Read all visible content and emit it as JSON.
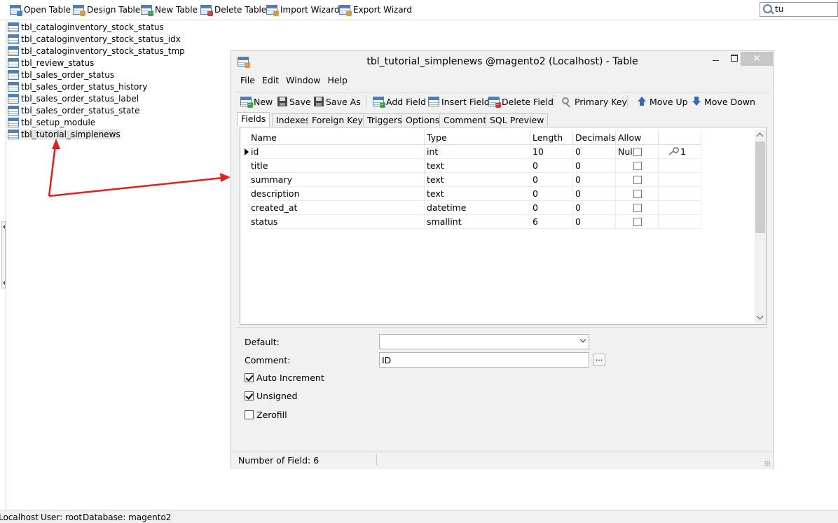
{
  "toolbar": {
    "open_table": "Open Table",
    "design_table": "Design Table",
    "new_table": "New Table",
    "delete_table": "Delete Table",
    "import_wizard": "Import Wizard",
    "export_wizard": "Export Wizard"
  },
  "search": {
    "value": "tu"
  },
  "tree": {
    "items": [
      "tbl_cataloginventory_stock_status",
      "tbl_cataloginventory_stock_status_idx",
      "tbl_cataloginventory_stock_status_tmp",
      "tbl_review_status",
      "tbl_sales_order_status",
      "tbl_sales_order_status_history",
      "tbl_sales_order_status_label",
      "tbl_sales_order_status_state",
      "tbl_setup_module",
      "tbl_tutorial_simplenews"
    ],
    "selected_index": 9
  },
  "window": {
    "title": "tbl_tutorial_simplenews @magento2 (Localhost) - Table",
    "close_glyph": "✕"
  },
  "menu": {
    "file": "File",
    "edit": "Edit",
    "window": "Window",
    "help": "Help"
  },
  "design_toolbar": {
    "new": "New",
    "save": "Save",
    "save_as": "Save As",
    "add_field": "Add Field",
    "insert_field": "Insert Field",
    "delete_field": "Delete Field",
    "primary_key": "Primary Key",
    "move_up": "Move Up",
    "move_down": "Move Down"
  },
  "tabs": [
    "Fields",
    "Indexes",
    "Foreign Keys",
    "Triggers",
    "Options",
    "Comment",
    "SQL Preview"
  ],
  "active_tab": "Fields",
  "grid": {
    "headers": {
      "name": "Name",
      "type": "Type",
      "length": "Length",
      "decimals": "Decimals",
      "allow_null": "Allow Null"
    },
    "rows": [
      {
        "name": "id",
        "type": "int",
        "length": "10",
        "decimals": "0",
        "allow_null": false,
        "key": "1"
      },
      {
        "name": "title",
        "type": "text",
        "length": "0",
        "decimals": "0",
        "allow_null": false,
        "key": ""
      },
      {
        "name": "summary",
        "type": "text",
        "length": "0",
        "decimals": "0",
        "allow_null": false,
        "key": ""
      },
      {
        "name": "description",
        "type": "text",
        "length": "0",
        "decimals": "0",
        "allow_null": false,
        "key": ""
      },
      {
        "name": "created_at",
        "type": "datetime",
        "length": "0",
        "decimals": "0",
        "allow_null": false,
        "key": ""
      },
      {
        "name": "status",
        "type": "smallint",
        "length": "6",
        "decimals": "0",
        "allow_null": false,
        "key": ""
      }
    ]
  },
  "properties": {
    "default_label": "Default:",
    "default_value": "",
    "comment_label": "Comment:",
    "comment_value": "ID",
    "comment_button": "...",
    "auto_increment_label": "Auto Increment",
    "auto_increment": true,
    "unsigned_label": "Unsigned",
    "unsigned": true,
    "zerofill_label": "Zerofill",
    "zerofill": false
  },
  "window_status": {
    "field_count": "Number of Field: 6"
  },
  "status_bar": {
    "connection": "Localhost",
    "user": "User: root",
    "database": "Database: magento2"
  },
  "colors": {
    "annotation_arrow": "#e0201f",
    "table_icon": "#4f7fb4"
  }
}
